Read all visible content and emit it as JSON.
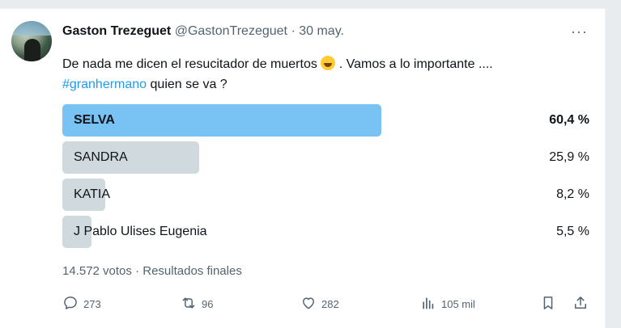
{
  "tweet": {
    "author_name": "Gaston Trezeguet",
    "handle": "@GastonTrezeguet",
    "separator": "·",
    "date": "30 may.",
    "more_label": "···",
    "text_line1_a": "De nada me dicen el resucitador de muertos ",
    "emoji": "rolling-on-floor-laughing-emoji",
    "text_line1_b": " . Vamos a lo importante ....",
    "hashtag": "#granhermano",
    "text_line2": " quien se va ?"
  },
  "poll": {
    "options": [
      {
        "label": "SELVA",
        "percent": "60,4 %",
        "fraction": 0.604,
        "winner": true
      },
      {
        "label": "SANDRA",
        "percent": "25,9 %",
        "fraction": 0.259,
        "winner": false
      },
      {
        "label": "KATIA",
        "percent": "8,2 %",
        "fraction": 0.082,
        "winner": false
      },
      {
        "label": "J Pablo Ulises Eugenia",
        "percent": "5,5 %",
        "fraction": 0.055,
        "winner": false
      }
    ],
    "votes": "14.572 votos",
    "dot": "·",
    "status": "Resultados finales"
  },
  "actions": {
    "reply_count": "273",
    "retweet_count": "96",
    "like_count": "282",
    "views_count": "105 mil"
  },
  "colors": {
    "winner_bar": "#79c2f4",
    "bar": "#cfd9de",
    "link": "#1d9bf0",
    "muted": "#536471"
  }
}
